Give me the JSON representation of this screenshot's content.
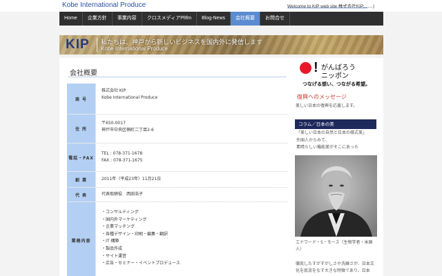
{
  "header": {
    "site_title": "Kobe International Produce",
    "welcome": "Welcome to KIP web site 株式会社KIP........)"
  },
  "nav": [
    {
      "label": "Home",
      "active": false
    },
    {
      "label": "企業方針",
      "active": false
    },
    {
      "label": "事業内容",
      "active": false
    },
    {
      "label": "クロスメディアPltfm",
      "active": false
    },
    {
      "label": "Blog-News",
      "active": false
    },
    {
      "label": "会社概要",
      "active": true
    },
    {
      "label": "お問合せ",
      "active": false
    }
  ],
  "banner": {
    "logo": "KIP",
    "line1": "私たちは、神戸から新しいビジネスを国内外に発信します",
    "line2": "Kobe International Produce"
  },
  "main": {
    "title": "会社概要",
    "rows": [
      {
        "label": "商 号",
        "lines": [
          "株式会社 KIP",
          "Kobe International Produce"
        ]
      },
      {
        "label": "住 所",
        "lines": [
          "〒650-0017",
          "神戸市中央区楠町二丁目2-6"
        ]
      },
      {
        "label": "電話・FAX",
        "lines": [
          "TEL : 078-371-1678",
          "FAX : 078-371-1675"
        ]
      },
      {
        "label": "創 業",
        "lines": [
          "2011年（平成23年）11月21日"
        ]
      },
      {
        "label": "代 表",
        "lines": [
          "代表取締役　西田浩子"
        ]
      },
      {
        "label": "業務内容",
        "lines": [
          "・コンサルティング",
          "・国内外マーケティング",
          "・企業マッチング",
          "・各種デザイン・印刷・編集・翻訳",
          "・IT 構築",
          "・製品作成",
          "・サイト運営",
          "・広告・セミナー・イベントプロデュース"
        ]
      }
    ]
  },
  "sidebar": {
    "ganbarou": {
      "line1": "がんばろう",
      "line2": "ニッポン",
      "tagline": "つなげる想い、つながる希望。"
    },
    "recovery_title": "復興へのメッセージ",
    "recovery_text": "美しい日本の復興を応援します。",
    "column_title": "コラム／日本の美",
    "column_lines": [
      "「美しい日本の自然と日本の様式美」",
      "外国人からみて、",
      "素晴らしい機能美がそこにあった"
    ],
    "caption": "エドワード・S・モース（生物学者・米国人）",
    "caption2": "徹底したすがすがしさや洗練さが、日本文化を底流をなす大きな特徴であり、日本"
  },
  "colors": {
    "nav_bg": "#2f2f2f",
    "nav_active": "#5b8bd0",
    "label_bg": "#b3d0f4",
    "column_head": "#1e2a5c",
    "red_circle": "#e8182b"
  }
}
